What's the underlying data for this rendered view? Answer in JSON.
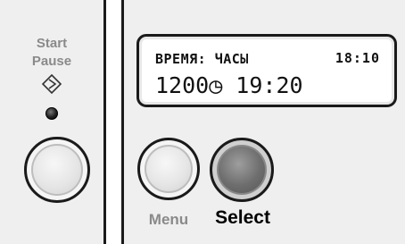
{
  "left_panel": {
    "start_label": "Start",
    "pause_label": "Pause",
    "start_icon": "diamond-start-icon",
    "led": "indicator-led"
  },
  "display": {
    "line1": "ВРЕМЯ: ЧАСЫ",
    "clock": "18:10",
    "line2": "1200◷ 19:20"
  },
  "buttons": {
    "menu_label": "Menu",
    "select_label": "Select"
  }
}
